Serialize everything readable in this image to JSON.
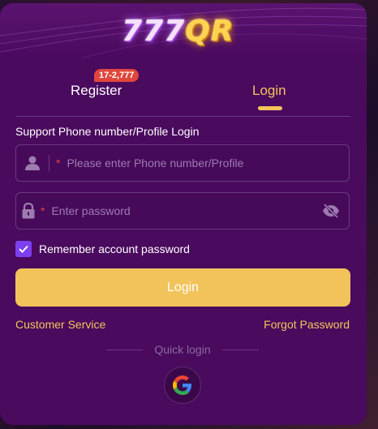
{
  "brand": {
    "part1": "777",
    "part2": "QR"
  },
  "tabs": {
    "register_label": "Register",
    "login_label": "Login",
    "badge": "17-2,777",
    "active": "login"
  },
  "form": {
    "section_label": "Support Phone number/Profile Login",
    "phone_placeholder": "Please enter Phone number/Profile",
    "password_placeholder": "Enter password",
    "required_mark": "*",
    "remember_label": "Remember account password",
    "remember_checked": true,
    "login_button": "Login"
  },
  "links": {
    "customer_service": "Customer Service",
    "forgot_password": "Forgot Password"
  },
  "quick_login": {
    "label": "Quick login",
    "providers": [
      "google-icon"
    ]
  },
  "icons": [
    "user-icon",
    "lock-icon",
    "eye-off-icon",
    "check-icon",
    "google-icon"
  ],
  "colors": {
    "background": "#4a0a5e",
    "accent": "#f4c45c",
    "button": "#f2c35a",
    "badge": "#e0463c",
    "checkbox": "#7d3ff0"
  }
}
